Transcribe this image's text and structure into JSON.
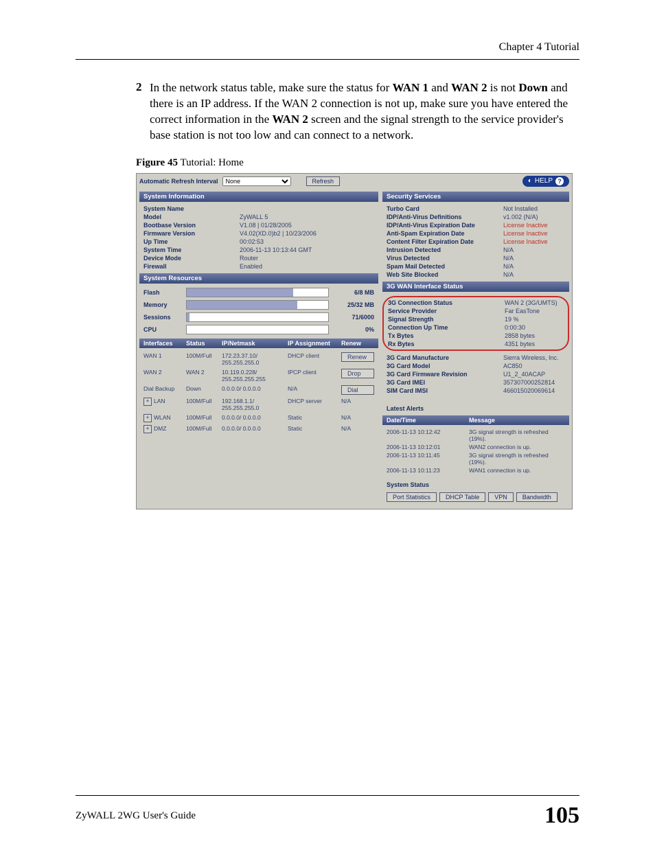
{
  "header": {
    "chapter": "Chapter 4 Tutorial"
  },
  "step": {
    "num": "2",
    "text_before": "In the network status table, make sure the status for ",
    "wan1": "WAN 1",
    "and": " and ",
    "wan2": "WAN 2",
    "mid": " is not ",
    "down": "Down",
    "after": " and there is an IP address. If the WAN 2 connection is not up, make sure you have entered the correct information in the ",
    "wan2_screen": "WAN 2",
    "tail": " screen and the signal strength to the service provider's base station is not too low and can connect to a network."
  },
  "figure": {
    "label": "Figure 45",
    "title": "   Tutorial: Home"
  },
  "topbar": {
    "refresh_label": "Automatic Refresh Interval",
    "refresh_option": "None",
    "refresh_btn": "Refresh",
    "help": "HELP",
    "help_icon": "?"
  },
  "sysinfo": {
    "title": "System Information",
    "rows": [
      {
        "k": "System Name",
        "v": ""
      },
      {
        "k": "Model",
        "v": "ZyWALL 5"
      },
      {
        "k": "Bootbase Version",
        "v": "V1.08 | 01/28/2005"
      },
      {
        "k": "Firmware Version",
        "v": "V4.02(XD.0)b2 | 10/23/2006"
      },
      {
        "k": "Up Time",
        "v": "00:02:53"
      },
      {
        "k": "System Time",
        "v": "2006-11-13 10:13:44 GMT"
      },
      {
        "k": "Device Mode",
        "v": "Router"
      },
      {
        "k": "Firewall",
        "v": "Enabled"
      }
    ]
  },
  "sysres": {
    "title": "System Resources",
    "rows": [
      {
        "k": "Flash",
        "v": "6/8 MB",
        "pct": 75
      },
      {
        "k": "Memory",
        "v": "25/32 MB",
        "pct": 78
      },
      {
        "k": "Sessions",
        "v": "71/6000",
        "pct": 2
      },
      {
        "k": "CPU",
        "v": "0%",
        "pct": 0
      }
    ]
  },
  "ifaces": {
    "hdr": {
      "a": "Interfaces",
      "b": "Status",
      "c": "IP/Netmask",
      "d": "IP Assignment",
      "e": "Renew"
    },
    "rows": [
      {
        "name": "WAN 1",
        "status": "100M/Full",
        "ip": "172.23.37.10/ 255.255.255.0",
        "assign": "DHCP client",
        "btn": "Renew",
        "exp": false
      },
      {
        "name": "WAN 2",
        "status": "WAN 2",
        "ip": "10.119.0.228/ 255.255.255.255",
        "assign": "IPCP client",
        "btn": "Drop",
        "exp": false
      },
      {
        "name": "Dial Backup",
        "status": "Down",
        "ip": "0.0.0.0/ 0.0.0.0",
        "assign": "N/A",
        "btn": "Dial",
        "exp": false
      },
      {
        "name": "LAN",
        "status": "100M/Full",
        "ip": "192.168.1.1/ 255.255.255.0",
        "assign": "DHCP server",
        "btn": "N/A",
        "exp": true
      },
      {
        "name": "WLAN",
        "status": "100M/Full",
        "ip": "0.0.0.0/ 0.0.0.0",
        "assign": "Static",
        "btn": "N/A",
        "exp": true
      },
      {
        "name": "DMZ",
        "status": "100M/Full",
        "ip": "0.0.0.0/ 0.0.0.0",
        "assign": "Static",
        "btn": "N/A",
        "exp": true
      }
    ]
  },
  "secsvc": {
    "title": "Security Services",
    "rows": [
      {
        "k": "Turbo Card",
        "v": "Not Installed"
      },
      {
        "k": "IDP/Anti-Virus Definitions",
        "v": "v1.002 (N/A)"
      },
      {
        "k": "IDP/Anti-Virus Expiration Date",
        "v": "License Inactive",
        "red": true
      },
      {
        "k": "Anti-Spam Expiration Date",
        "v": "License Inactive",
        "red": true
      },
      {
        "k": "Content Filter Expiration Date",
        "v": "License Inactive",
        "red": true
      },
      {
        "k": "Intrusion Detected",
        "v": "N/A"
      },
      {
        "k": "Virus Detected",
        "v": "N/A"
      },
      {
        "k": "Spam Mail Detected",
        "v": "N/A"
      },
      {
        "k": "Web Site Blocked",
        "v": "N/A"
      }
    ]
  },
  "wan3g": {
    "title": "3G WAN Interface Status",
    "highlight_rows": [
      {
        "k": "3G Connection Status",
        "v": "WAN 2 (3G/UMTS)"
      },
      {
        "k": "Service Provider",
        "v": "Far EasTone"
      },
      {
        "k": "Signal Strength",
        "v": "19 %"
      },
      {
        "k": "Connection Up Time",
        "v": "0:00:30"
      },
      {
        "k": "Tx Bytes",
        "v": "2858 bytes"
      },
      {
        "k": "Rx Bytes",
        "v": "4351 bytes"
      }
    ],
    "rows": [
      {
        "k": "3G Card Manufacture",
        "v": "Sierra Wireless, Inc."
      },
      {
        "k": "3G Card Model",
        "v": "AC850"
      },
      {
        "k": "3G Card Firmware Revision",
        "v": "U1_2_40ACAP"
      },
      {
        "k": "3G Card IMEI",
        "v": "357307000252814"
      },
      {
        "k": "SIM Card IMSI",
        "v": "466015020069614"
      }
    ]
  },
  "alerts": {
    "title": "Latest Alerts",
    "hdr": {
      "a": "Date/Time",
      "b": "Message"
    },
    "rows": [
      {
        "t": "2006-11-13 10:12:42",
        "m": "3G signal strength is refreshed (19%)."
      },
      {
        "t": "2006-11-13 10:12:01",
        "m": "WAN2 connection is up."
      },
      {
        "t": "2006-11-13 10:11:45",
        "m": "3G signal strength is refreshed (19%)."
      },
      {
        "t": "2006-11-13 10:11:23",
        "m": "WAN1 connection is up."
      }
    ]
  },
  "sysstatus": {
    "label": "System Status",
    "btns": [
      "Port Statistics",
      "DHCP Table",
      "VPN",
      "Bandwidth"
    ]
  },
  "footer": {
    "guide": "ZyWALL 2WG User's Guide",
    "page": "105"
  }
}
